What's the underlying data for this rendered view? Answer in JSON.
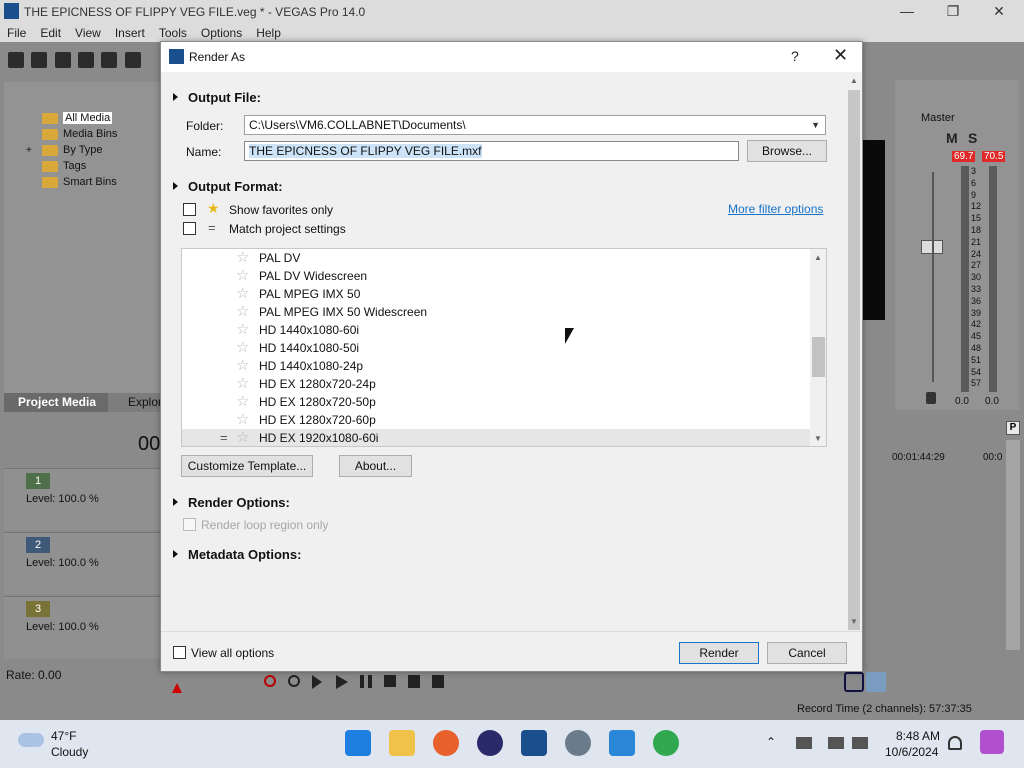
{
  "window": {
    "title": "THE EPICNESS OF FLIPPY VEG FILE.veg * - VEGAS Pro 14.0",
    "minimize": "—",
    "maximize": "❐",
    "close": "✕"
  },
  "menu": [
    "File",
    "Edit",
    "View",
    "Insert",
    "Tools",
    "Options",
    "Help"
  ],
  "media_tree": {
    "items": [
      {
        "label": "All Media",
        "selected": true
      },
      {
        "label": "Media Bins"
      },
      {
        "label": "By Type",
        "expand": "+"
      },
      {
        "label": "Tags"
      },
      {
        "label": "Smart Bins"
      }
    ],
    "tabs": {
      "project_media": "Project Media",
      "explorer": "Explor"
    }
  },
  "timecode_partial": "00",
  "tracks": [
    {
      "num": "1",
      "level": "Level: 100.0 %",
      "color": "#4f7a4a"
    },
    {
      "num": "2",
      "level": "Level: 100.0 %",
      "color": "#3e5a78"
    },
    {
      "num": "3",
      "level": "Level: 100.0 %",
      "color": "#7a7338"
    }
  ],
  "master": {
    "label": "Master",
    "m": "M",
    "s": "S",
    "peak_left": "69.7",
    "peak_right": "70.5",
    "scale": [
      "3",
      "6",
      "9",
      "12",
      "15",
      "18",
      "21",
      "24",
      "27",
      "30",
      "33",
      "36",
      "39",
      "42",
      "45",
      "48",
      "51",
      "54",
      "57"
    ],
    "bottom_left": "0.0",
    "bottom_right": "0.0"
  },
  "timeline": {
    "ruler_time": "00:01:44:29",
    "ruler_time2": "00:0",
    "marker": "P"
  },
  "rate": "Rate: 0.00",
  "record_time": "Record Time (2 channels): 57:37:35",
  "dialog": {
    "title": "Render As",
    "help": "?",
    "close": "✕",
    "output_file": {
      "heading": "Output File:",
      "folder_label": "Folder:",
      "folder_value": "C:\\Users\\VM6.COLLABNET\\Documents\\",
      "name_label": "Name:",
      "name_value": "THE EPICNESS OF FLIPPY VEG FILE.mxf",
      "browse": "Browse..."
    },
    "output_format": {
      "heading": "Output Format:",
      "show_favorites": "Show favorites only",
      "match_project": "Match project settings",
      "more_filter": "More filter options",
      "templates": [
        "PAL DV",
        "PAL DV Widescreen",
        "PAL MPEG IMX 50",
        "PAL MPEG IMX 50 Widescreen",
        "HD 1440x1080-60i",
        "HD 1440x1080-50i",
        "HD 1440x1080-24p",
        "HD EX 1280x720-24p",
        "HD EX 1280x720-50p",
        "HD EX 1280x720-60p",
        "HD EX 1920x1080-60i"
      ],
      "selected_index": 10,
      "customize": "Customize Template...",
      "about": "About..."
    },
    "render_options": {
      "heading": "Render Options:",
      "loop_region": "Render loop region only"
    },
    "metadata_options": {
      "heading": "Metadata Options:"
    },
    "view_all": "View all options",
    "render_btn": "Render",
    "cancel_btn": "Cancel"
  },
  "taskbar": {
    "weather_temp": "47°F",
    "weather_desc": "Cloudy",
    "time": "8:48 AM",
    "date": "10/6/2024"
  }
}
